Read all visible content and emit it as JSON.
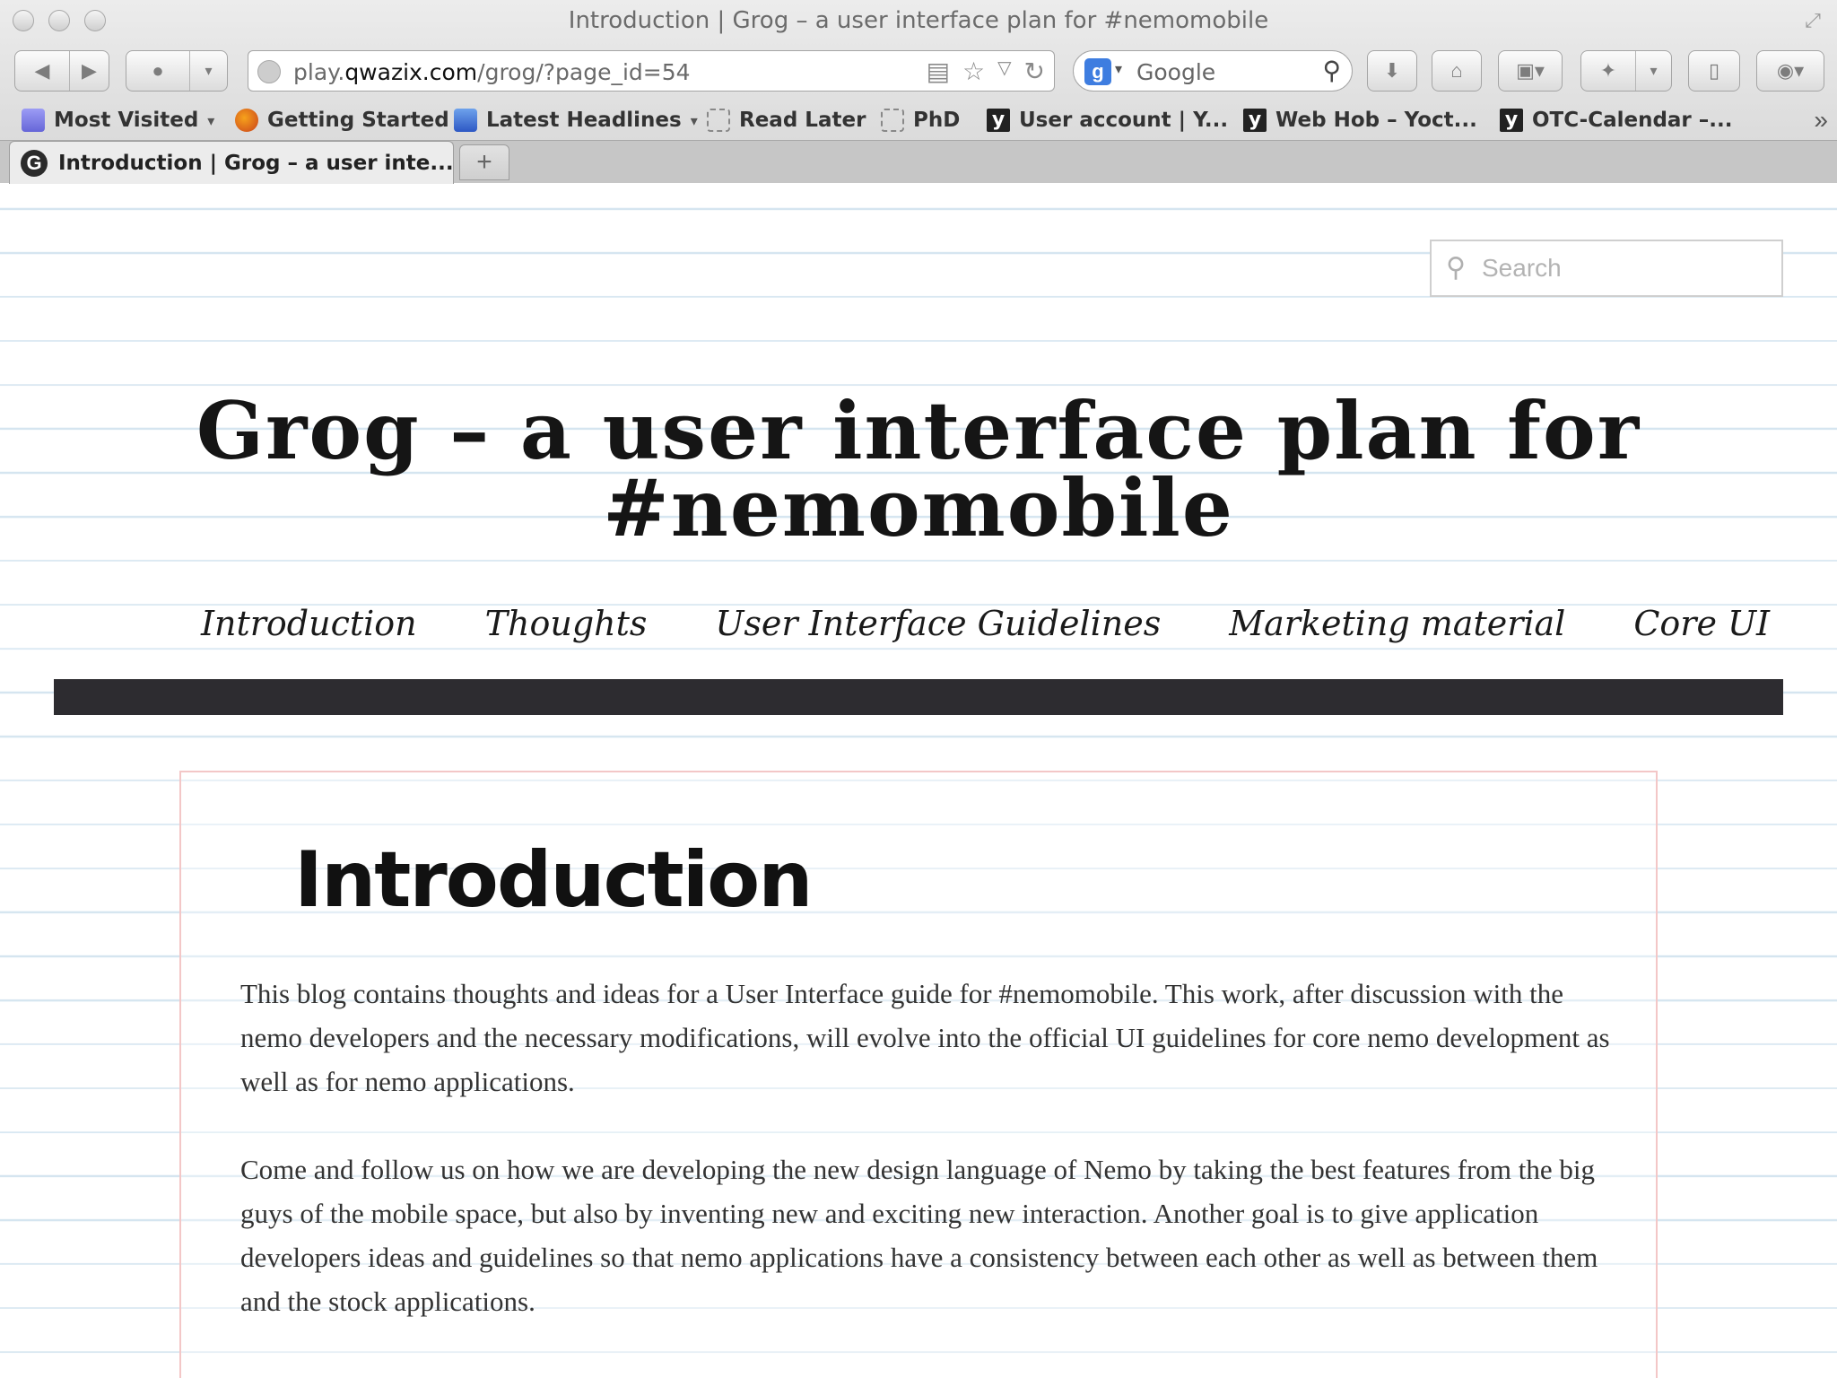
{
  "window": {
    "title": "Introduction | Grog – a user interface plan for #nemomobile"
  },
  "toolbar": {
    "url_prefix": "play.",
    "url_domain": "qwazix.com",
    "url_path": "/grog/?page_id=54",
    "search_engine": "Google"
  },
  "bookmarks": [
    {
      "label": "Most Visited",
      "icon": "folder-icon",
      "dropdown": true
    },
    {
      "label": "Getting Started",
      "icon": "firefox-icon",
      "dropdown": false
    },
    {
      "label": "Latest Headlines",
      "icon": "rss-icon",
      "dropdown": true
    },
    {
      "label": "Read Later",
      "icon": "blank-page-icon",
      "dropdown": false
    },
    {
      "label": "PhD",
      "icon": "blank-page-icon",
      "dropdown": false
    },
    {
      "label": "User account | Y...",
      "icon": "yocto-icon",
      "dropdown": false
    },
    {
      "label": "Web Hob – Yoct...",
      "icon": "yocto-icon",
      "dropdown": false
    },
    {
      "label": "OTC-Calendar –...",
      "icon": "yocto-icon",
      "dropdown": false
    }
  ],
  "tab": {
    "label": "Introduction | Grog – a user inte..."
  },
  "site": {
    "search_placeholder": "Search",
    "title": "Grog – a user interface plan for #nemomobile",
    "nav": [
      "Introduction",
      "Thoughts",
      "User Interface Guidelines",
      "Marketing material",
      "Core UI"
    ]
  },
  "entry": {
    "title": "Introduction",
    "paragraphs": [
      "This blog contains thoughts and ideas for a User Interface guide for #nemomobile. This work, after discussion with the nemo developers and the necessary modifications, will evolve into the official UI guidelines for core nemo development as well as for nemo applications.",
      "Come and follow us on how we are developing the new design language of Nemo by taking the best features from the big guys of the mobile space, but also by inventing new and exciting new interaction. Another goal is to give application developers ideas and guidelines so that nemo applications have a consistency between each other as well as between them and the stock applications."
    ]
  },
  "colors": {
    "nav_rule": "#2d2c30",
    "notebook_line": "#d5e5f0",
    "card_border": "#f3c7c7"
  }
}
